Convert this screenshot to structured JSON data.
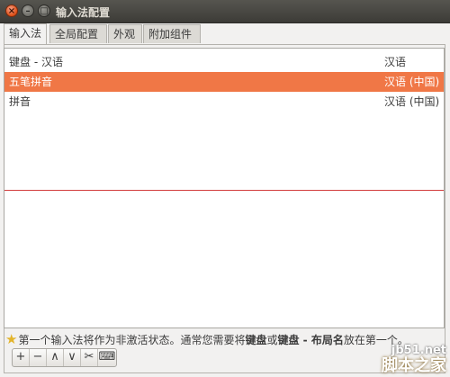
{
  "window": {
    "title": "输入法配置",
    "close_glyph": "×",
    "min_glyph": "–",
    "max_glyph": "□"
  },
  "tabs": [
    {
      "label": "输入法"
    },
    {
      "label": "全局配置"
    },
    {
      "label": "外观"
    },
    {
      "label": "附加组件"
    }
  ],
  "im_list": {
    "rows": [
      {
        "name": "键盘 - 汉语",
        "language": "汉语"
      },
      {
        "name": "五笔拼音",
        "language": "汉语 (中国)"
      },
      {
        "name": "拼音",
        "language": "汉语 (中国)"
      }
    ],
    "selected_index": 1
  },
  "hint": {
    "part1": "第一个输入法将作为非激活状态。通常您需要将",
    "bold1": "键盘",
    "part2": "或",
    "bold2": "键盘 - 布局名",
    "part3": "放在第一个。"
  },
  "toolbar": {
    "add": "+",
    "remove": "−",
    "up": "∧",
    "down": "∨",
    "configure": "✂",
    "keyboard": "⌨"
  },
  "watermark": {
    "url": "jb51.net",
    "name": "脚本之家"
  },
  "colors": {
    "selection": "#f07746",
    "title_bar": "#3c3b37",
    "separator_line": "#d23c3c"
  }
}
